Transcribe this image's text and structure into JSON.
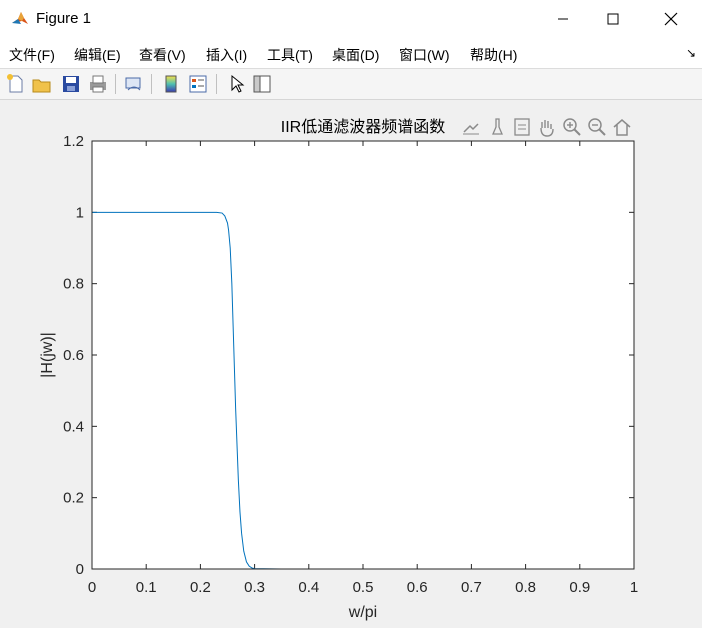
{
  "window": {
    "title": "Figure 1"
  },
  "menu": {
    "items": [
      {
        "label": "文件(F)",
        "name": "menu-file"
      },
      {
        "label": "编辑(E)",
        "name": "menu-edit"
      },
      {
        "label": "查看(V)",
        "name": "menu-view"
      },
      {
        "label": "插入(I)",
        "name": "menu-insert"
      },
      {
        "label": "工具(T)",
        "name": "menu-tools"
      },
      {
        "label": "桌面(D)",
        "name": "menu-desktop"
      },
      {
        "label": "窗口(W)",
        "name": "menu-window"
      },
      {
        "label": "帮助(H)",
        "name": "menu-help"
      }
    ]
  },
  "toolbar": {
    "icons": [
      "new-figure-icon",
      "open-file-icon",
      "save-icon",
      "print-icon",
      "link-plot-icon",
      "insert-colorbar-icon",
      "insert-legend-icon",
      "edit-plot-pointer-icon",
      "property-inspector-icon"
    ]
  },
  "axes_toolbar": {
    "icons": [
      "export-icon",
      "brush-icon",
      "datatip-icon",
      "pan-icon",
      "zoom-in-icon",
      "zoom-out-icon",
      "restore-view-icon"
    ]
  },
  "chart_data": {
    "type": "line",
    "title": "IIR低通滤波器频谱函数",
    "xlabel": "w/pi",
    "ylabel": "|H(jw)|",
    "xlim": [
      0,
      1
    ],
    "ylim": [
      0,
      1.2
    ],
    "xticks": [
      "0",
      "0.1",
      "0.2",
      "0.3",
      "0.4",
      "0.5",
      "0.6",
      "0.7",
      "0.8",
      "0.9",
      "1"
    ],
    "yticks": [
      "0",
      "0.2",
      "0.4",
      "0.6",
      "0.8",
      "1",
      "1.2"
    ],
    "grid": false,
    "line_color": "#0072bd",
    "series": [
      {
        "x": [
          0,
          0.05,
          0.1,
          0.15,
          0.2,
          0.23,
          0.24,
          0.245,
          0.25,
          0.252,
          0.255,
          0.258,
          0.26,
          0.263,
          0.265,
          0.268,
          0.27,
          0.273,
          0.276,
          0.28,
          0.285,
          0.29,
          0.295,
          0.3,
          0.35,
          0.4,
          0.5,
          0.6,
          0.7,
          0.8,
          0.9,
          1.0
        ],
        "y": [
          1,
          1,
          1,
          1,
          1,
          1,
          0.998,
          0.99,
          0.97,
          0.95,
          0.9,
          0.8,
          0.7,
          0.55,
          0.45,
          0.33,
          0.25,
          0.16,
          0.1,
          0.05,
          0.02,
          0.008,
          0.003,
          0.001,
          0,
          0,
          0,
          0,
          0,
          0,
          0,
          0
        ]
      }
    ]
  }
}
